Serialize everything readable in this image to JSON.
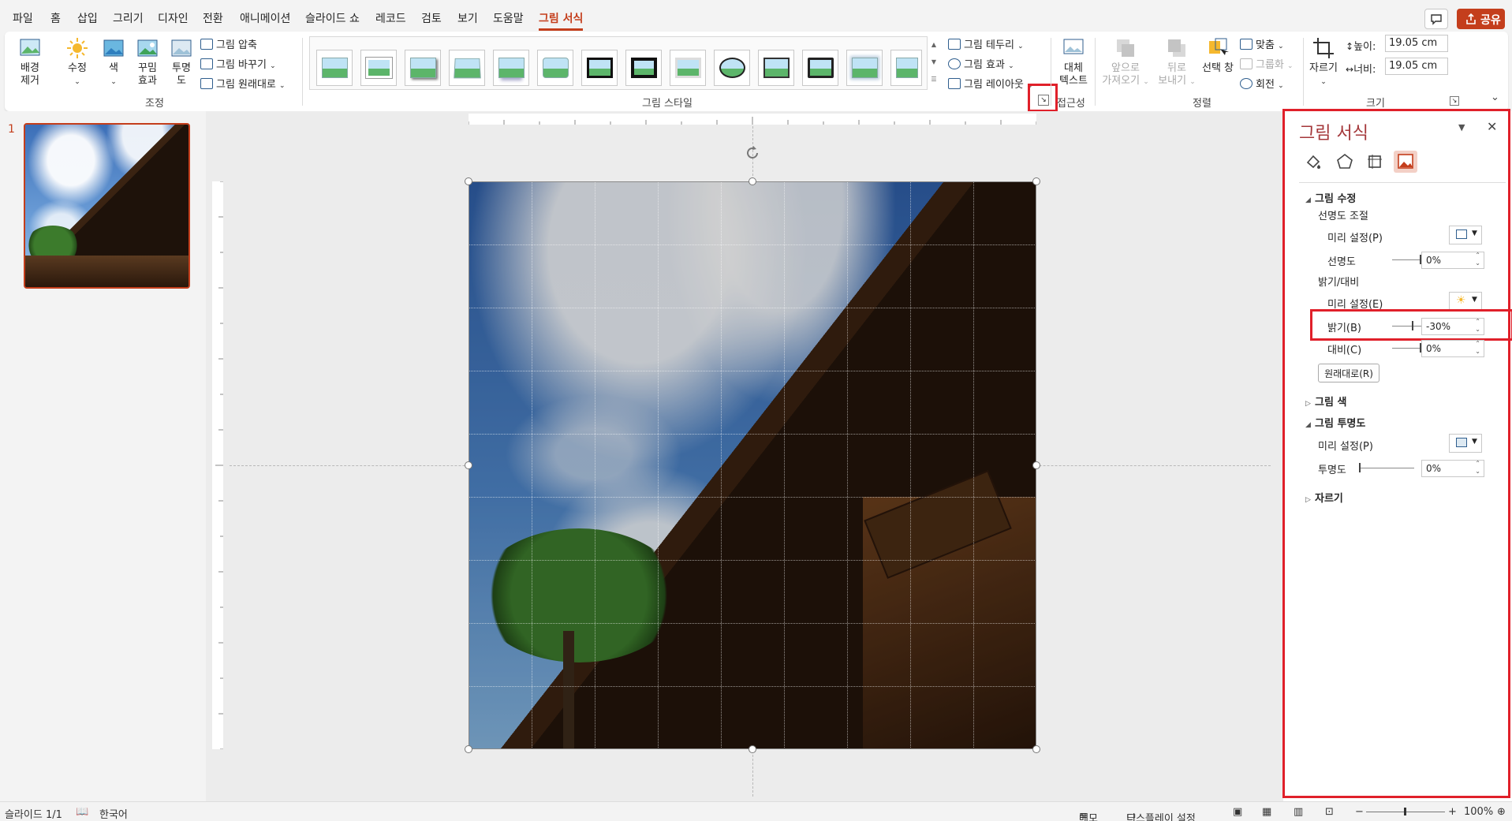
{
  "menu": {
    "tabs": [
      "파일",
      "홈",
      "삽입",
      "그리기",
      "디자인",
      "전환",
      "애니메이션",
      "슬라이드 쇼",
      "레코드",
      "검토",
      "보기",
      "도움말",
      "그림 서식"
    ],
    "share_label": "공유"
  },
  "ribbon": {
    "adjust": {
      "remove_bg": "배경\n제거",
      "corrections": "수정",
      "color": "색",
      "artistic": "꾸밈\n효과",
      "transparency": "투명\n도",
      "compress": "그림 압축",
      "change": "그림 바꾸기",
      "reset": "그림 원래대로",
      "group_label": "조정"
    },
    "styles": {
      "group_label": "그림 스타일",
      "border": "그림 테두리",
      "effects": "그림 효과",
      "layout": "그림 레이아웃"
    },
    "accessibility": {
      "alt_text": "대체\n텍스트",
      "group_label": "접근성"
    },
    "arrange": {
      "bring_forward": "앞으로\n가져오기",
      "send_backward": "뒤로\n보내기",
      "selection_pane": "선택 창",
      "align": "맞춤",
      "group": "그룹화",
      "rotate": "회전",
      "group_label": "정렬"
    },
    "size": {
      "crop": "자르기",
      "height_label": "높이:",
      "height_value": "19.05 cm",
      "width_label": "너비:",
      "width_value": "19.05 cm",
      "group_label": "크기"
    }
  },
  "thumbs": {
    "slide_number": "1"
  },
  "format_pane": {
    "title": "그림 서식",
    "picture_corrections": "그림 수정",
    "sharpen_soften": "선명도 조절",
    "preset_p": "미리 설정(P)",
    "sharpness_label": "선명도",
    "sharpness_value": "0%",
    "sharpness": 0,
    "brightness_contrast": "밝기/대비",
    "preset_e": "미리 설정(E)",
    "brightness_label": "밝기(B)",
    "brightness_value": "-30%",
    "brightness": -30,
    "contrast_label": "대비(C)",
    "contrast_value": "0%",
    "contrast": 0,
    "reset_button": "원래대로(R)",
    "picture_color": "그림 색",
    "picture_transparency": "그림 투명도",
    "preset_p2": "미리 설정(P)",
    "transparency_label": "투명도",
    "transparency_value": "0%",
    "transparency": 0,
    "crop": "자르기"
  },
  "status": {
    "slide": "슬라이드 1/1",
    "language": "한국어",
    "notes": "메모",
    "display_settings": "디스플레이 설정",
    "zoom": "100%"
  },
  "colors": {
    "accent": "#c43e1c",
    "highlight": "#e0202a"
  }
}
